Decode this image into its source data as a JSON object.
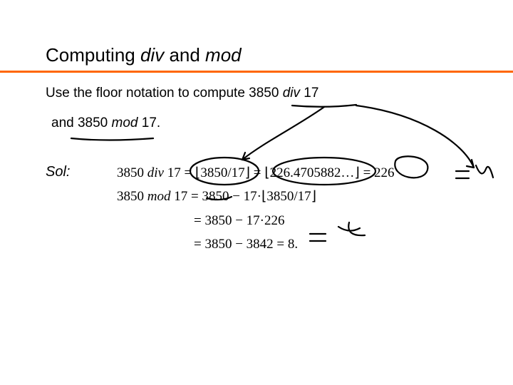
{
  "slide": {
    "title_pre": "Computing ",
    "title_div": "div",
    "title_mid": " and ",
    "title_mod": "mod",
    "line1_pre": "Use the floor notation to compute 3850 ",
    "line1_div": "div",
    "line1_post": " 17",
    "line2_pre": "and 3850 ",
    "line2_mod": "mod",
    "line2_post": " 17.",
    "sol": "Sol:"
  },
  "eq": {
    "r1a": "3850 ",
    "r1b": "div",
    "r1c": " 17 = ⌊3850/17⌋ = ⌊226.4705882…⌋ = 226",
    "r2a": "3850 ",
    "r2b": "mod",
    "r2c": " 17 = 3850 − 17·⌊3850/17⌋",
    "r3": "= 3850 − 17·226",
    "r4": "= 3850 − 3842 = 8."
  },
  "math": {
    "dividend": 3850,
    "divisor": 17,
    "quotient_real": 226.4705882,
    "div_result": 226,
    "product": 3842,
    "mod_result": 8
  }
}
